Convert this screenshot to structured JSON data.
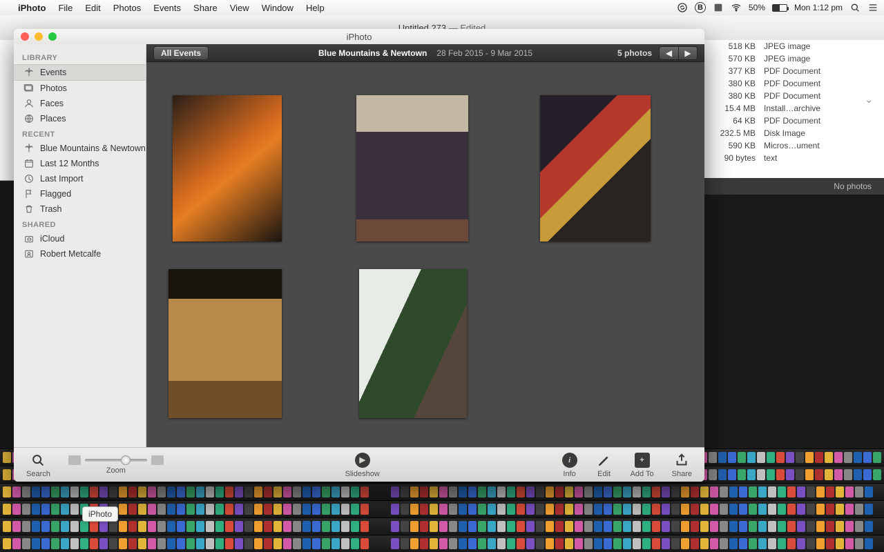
{
  "menubar": {
    "app": "iPhoto",
    "items": [
      "File",
      "Edit",
      "Photos",
      "Events",
      "Share",
      "View",
      "Window",
      "Help"
    ],
    "battery_pct": "50%",
    "clock": "Mon 1:12 pm"
  },
  "bg_window": {
    "title": "Untitled 273",
    "title_suffix": " — Edited",
    "rows": [
      {
        "size": "518 KB",
        "kind": "JPEG image"
      },
      {
        "size": "570 KB",
        "kind": "JPEG image"
      },
      {
        "size": "377 KB",
        "kind": "PDF Document"
      },
      {
        "size": "380 KB",
        "kind": "PDF Document"
      },
      {
        "size": "380 KB",
        "kind": "PDF Document"
      },
      {
        "size": "15.4 MB",
        "kind": "Install…archive"
      },
      {
        "size": "64 KB",
        "kind": "PDF Document"
      },
      {
        "size": "232.5 MB",
        "kind": "Disk Image"
      },
      {
        "size": "590 KB",
        "kind": "Micros…ument"
      },
      {
        "size": "90 bytes",
        "kind": "text"
      }
    ],
    "no_photos": "No photos"
  },
  "iphoto": {
    "title": "iPhoto",
    "sidebar": {
      "library_hdr": "LIBRARY",
      "library": [
        {
          "label": "Events",
          "sel": true,
          "icon": "palm"
        },
        {
          "label": "Photos",
          "sel": false,
          "icon": "photos"
        },
        {
          "label": "Faces",
          "sel": false,
          "icon": "faces"
        },
        {
          "label": "Places",
          "sel": false,
          "icon": "places"
        }
      ],
      "recent_hdr": "RECENT",
      "recent": [
        {
          "label": "Blue Mountains & Newtown",
          "icon": "palm"
        },
        {
          "label": "Last 12 Months",
          "icon": "calendar"
        },
        {
          "label": "Last Import",
          "icon": "import"
        },
        {
          "label": "Flagged",
          "icon": "flag"
        },
        {
          "label": "Trash",
          "icon": "trash"
        }
      ],
      "shared_hdr": "SHARED",
      "shared": [
        {
          "label": "iCloud",
          "icon": "cloud"
        },
        {
          "label": "Robert Metcalfe",
          "icon": "person"
        }
      ]
    },
    "eventbar": {
      "all_events": "All Events",
      "event_name": "Blue Mountains & Newtown",
      "date_range": "28 Feb 2015 - 9 Mar 2015",
      "count": "5 photos"
    },
    "toolbar": {
      "search": "Search",
      "zoom": "Zoom",
      "slideshow": "Slideshow",
      "info": "Info",
      "edit": "Edit",
      "addto": "Add To",
      "share": "Share"
    }
  },
  "tooltip": "iPhoto"
}
